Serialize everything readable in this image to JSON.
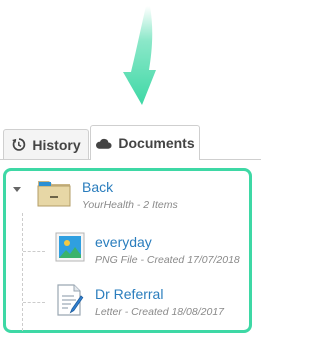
{
  "tabs": [
    {
      "label": "History",
      "icon": "history-icon",
      "active": false
    },
    {
      "label": "Documents",
      "icon": "cloud-icon",
      "active": true
    }
  ],
  "colors": {
    "highlight": "#3ed8a5",
    "link": "#2a7dbd",
    "meta": "#8a8a8a"
  },
  "documents": {
    "folder": {
      "name": "Back",
      "meta": "YourHealth - 2 Items",
      "icon": "folder-icon"
    },
    "items": [
      {
        "name": "everyday",
        "meta": "PNG File - Created 17/07/2018",
        "icon": "image-file-icon"
      },
      {
        "name": "Dr Referral",
        "meta": "Letter - Created 18/08/2017",
        "icon": "letter-file-icon"
      }
    ]
  }
}
